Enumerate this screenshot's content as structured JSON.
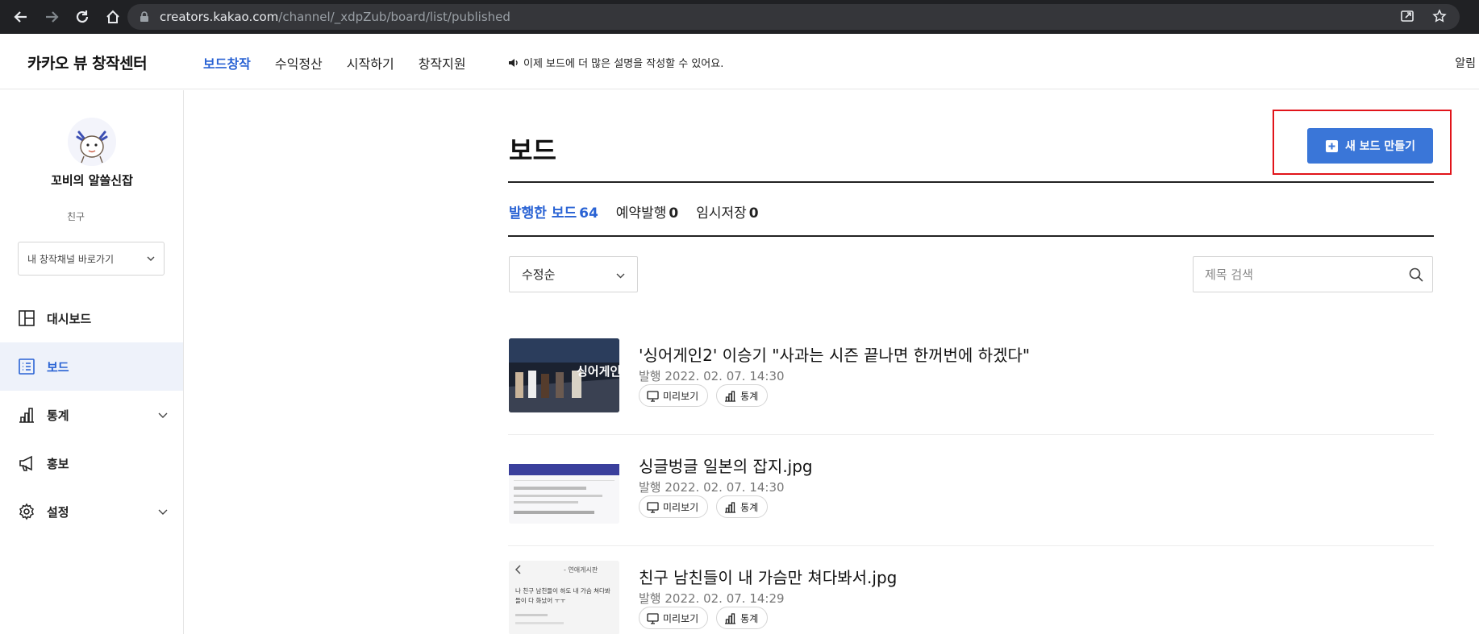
{
  "browser": {
    "url_host": "creators.kakao.com",
    "url_path": "/channel/_xdpZub/board/list/published"
  },
  "header": {
    "brand": "카카오 뷰 창작센터",
    "nav": [
      "보드창작",
      "수익정산",
      "시작하기",
      "창작지원"
    ],
    "notice": "이제 보드에 더 많은 설명을 작성할 수 있어요.",
    "alarm": "알림"
  },
  "sidebar": {
    "channel_name": "꼬비의 알쓸신잡",
    "friend_label": "친구",
    "channel_select": "내 창작채널 바로가기",
    "menu": [
      {
        "label": "대시보드",
        "icon": "dashboard-icon"
      },
      {
        "label": "보드",
        "icon": "board-list-icon"
      },
      {
        "label": "통계",
        "icon": "stats-icon"
      },
      {
        "label": "홍보",
        "icon": "megaphone-icon"
      },
      {
        "label": "설정",
        "icon": "gear-icon"
      }
    ]
  },
  "main": {
    "title": "보드",
    "new_board_button": "새 보드 만들기",
    "tabs": [
      {
        "label": "발행한 보드",
        "count": "64"
      },
      {
        "label": "예약발행",
        "count": "0"
      },
      {
        "label": "임시저장",
        "count": "0"
      }
    ],
    "sort_select": "수정순",
    "search_placeholder": "제목 검색",
    "preview_label": "미리보기",
    "stats_label": "통계",
    "boards": [
      {
        "title": "'싱어게인2' 이승기 \"사과는 시즌 끝나면 한꺼번에 하겠다\"",
        "meta": "발행 2022. 02. 07. 14:30",
        "thumb_text": "싱어게인"
      },
      {
        "title": "싱글벙글 일본의 잡지.jpg",
        "meta": "발행 2022. 02. 07. 14:30"
      },
      {
        "title": "친구 남친들이 내 가슴만 쳐다봐서.jpg",
        "meta": "발행 2022. 02. 07. 14:29",
        "thumb_header": "- 연애게시판",
        "thumb_lines": [
          "나 친구 남친들이 하도 내 가슴 쳐다봐",
          "들이 다 화났어 ㅜㅜ"
        ]
      }
    ]
  },
  "colors": {
    "accent": "#2a63d4",
    "button": "#3a76d8",
    "highlight": "#e1141a",
    "browser_bar": "#202124"
  }
}
